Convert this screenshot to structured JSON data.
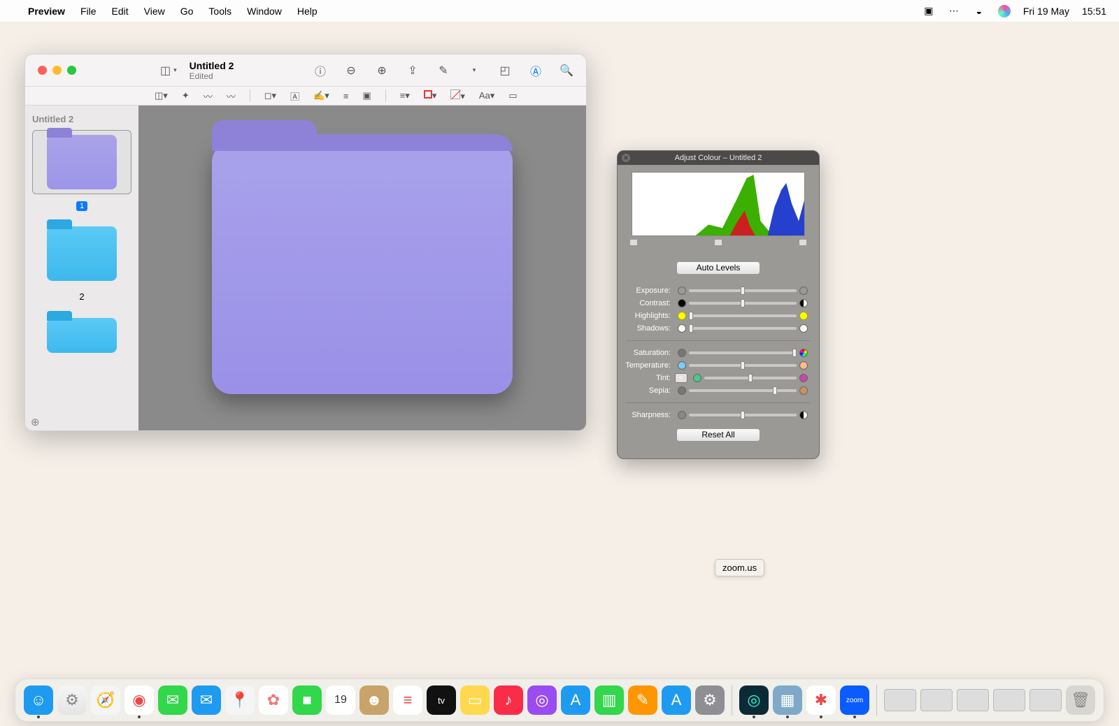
{
  "menubar": {
    "app": "Preview",
    "items": [
      "File",
      "Edit",
      "View",
      "Go",
      "Tools",
      "Window",
      "Help"
    ],
    "date": "Fri 19 May",
    "time": "15:51"
  },
  "window": {
    "title": "Untitled 2",
    "subtitle": "Edited",
    "sidebar_title": "Untitled 2",
    "thumbs": [
      {
        "num": "1",
        "selected": true,
        "color": "purple"
      },
      {
        "num": "2",
        "selected": false,
        "color": "blue"
      },
      {
        "num": "",
        "selected": false,
        "color": "blue"
      }
    ],
    "toolbar2_text": "Aa"
  },
  "adjust": {
    "title": "Adjust Colour – Untitled 2",
    "auto": "Auto Levels",
    "reset": "Reset All",
    "sliders": {
      "exposure": {
        "label": "Exposure:",
        "pos": 50
      },
      "contrast": {
        "label": "Contrast:",
        "pos": 50
      },
      "highlights": {
        "label": "Highlights:",
        "pos": 2
      },
      "shadows": {
        "label": "Shadows:",
        "pos": 2
      },
      "saturation": {
        "label": "Saturation:",
        "pos": 98
      },
      "temperature": {
        "label": "Temperature:",
        "pos": 50
      },
      "tint": {
        "label": "Tint:",
        "pos": 50
      },
      "sepia": {
        "label": "Sepia:",
        "pos": 80
      },
      "sharpness": {
        "label": "Sharpness:",
        "pos": 50
      }
    }
  },
  "tooltip": "zoom.us",
  "dock": {
    "left": [
      {
        "name": "finder",
        "bg": "#1e9bf0",
        "glyph": "☺",
        "running": true
      },
      {
        "name": "launchpad",
        "bg": "linear-gradient(#f5f5f5,#e5e5e5)",
        "glyph": "⚙",
        "txt": "#888"
      },
      {
        "name": "safari",
        "bg": "#f5f5f5",
        "glyph": "🧭"
      },
      {
        "name": "chrome",
        "bg": "#fff",
        "glyph": "◉",
        "txt": "#e44",
        "running": true
      },
      {
        "name": "messages",
        "bg": "#32d74b",
        "glyph": "✉"
      },
      {
        "name": "mail",
        "bg": "#1e9bf0",
        "glyph": "✉"
      },
      {
        "name": "maps",
        "bg": "#f5f5f5",
        "glyph": "📍"
      },
      {
        "name": "photos",
        "bg": "#fff",
        "glyph": "✿",
        "txt": "#e77"
      },
      {
        "name": "facetime",
        "bg": "#32d74b",
        "glyph": "■"
      },
      {
        "name": "calendar",
        "bg": "#fff",
        "glyph": "19",
        "txt": "#333",
        "fs": "16px"
      },
      {
        "name": "contacts",
        "bg": "#c8a46a",
        "glyph": "☻"
      },
      {
        "name": "reminders",
        "bg": "#fff",
        "glyph": "≡",
        "txt": "#e44"
      },
      {
        "name": "tv",
        "bg": "#111",
        "glyph": "tv",
        "fs": "13px"
      },
      {
        "name": "notes",
        "bg": "#ffd84d",
        "glyph": "▭"
      },
      {
        "name": "music",
        "bg": "#fa2d48",
        "glyph": "♪"
      },
      {
        "name": "podcasts",
        "bg": "#9a4cf0",
        "glyph": "◎"
      },
      {
        "name": "appstore-tools",
        "bg": "#1e9bf0",
        "glyph": "A"
      },
      {
        "name": "numbers",
        "bg": "#32d74b",
        "glyph": "▥"
      },
      {
        "name": "pages",
        "bg": "#ff9500",
        "glyph": "✎"
      },
      {
        "name": "appstore",
        "bg": "#1e9bf0",
        "glyph": "A"
      },
      {
        "name": "settings",
        "bg": "#8e8e93",
        "glyph": "⚙"
      }
    ],
    "mid": [
      {
        "name": "app-dark",
        "bg": "#0c2a36",
        "glyph": "◎",
        "txt": "#2fd",
        "running": true
      },
      {
        "name": "preview",
        "bg": "#7fa9c8",
        "glyph": "▦",
        "running": true
      },
      {
        "name": "slack",
        "bg": "#fff",
        "glyph": "✱",
        "txt": "#e44",
        "running": true
      },
      {
        "name": "zoom",
        "bg": "#0b5cff",
        "glyph": "zoom",
        "fs": "10px",
        "running": true
      }
    ]
  }
}
